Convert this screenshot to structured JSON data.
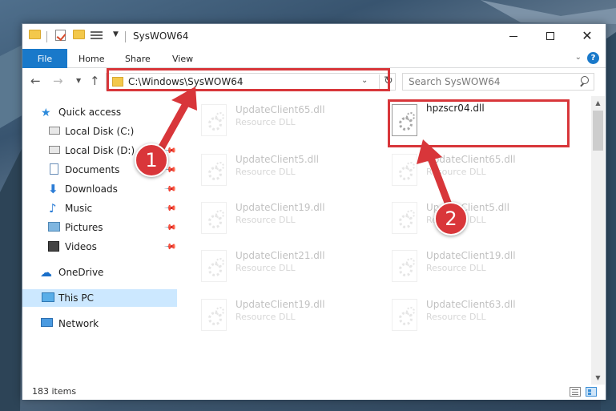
{
  "window": {
    "title": "SysWOW64"
  },
  "ribbon": {
    "tabs": [
      "File",
      "Home",
      "Share",
      "View"
    ]
  },
  "address": {
    "path": "C:\\Windows\\SysWOW64"
  },
  "search": {
    "placeholder": "Search SysWOW64"
  },
  "sidebar": {
    "items": [
      {
        "label": "Quick access",
        "icon": "star-icon"
      },
      {
        "label": "Local Disk (C:)",
        "icon": "drive-icon"
      },
      {
        "label": "Local Disk (D:)",
        "icon": "drive-icon"
      },
      {
        "label": "Documents",
        "icon": "documents-icon"
      },
      {
        "label": "Downloads",
        "icon": "download-icon"
      },
      {
        "label": "Music",
        "icon": "music-icon"
      },
      {
        "label": "Pictures",
        "icon": "pictures-icon"
      },
      {
        "label": "Videos",
        "icon": "videos-icon"
      },
      {
        "label": "OneDrive",
        "icon": "cloud-icon"
      },
      {
        "label": "This PC",
        "icon": "computer-icon"
      },
      {
        "label": "Network",
        "icon": "network-icon"
      }
    ]
  },
  "files": {
    "highlighted": {
      "name": "hpzscr04.dll"
    },
    "left_column": [
      {
        "name": "UpdateClient65.dll",
        "type": "Resource DLL"
      },
      {
        "name": "UpdateClient5.dll",
        "type": "Resource DLL"
      },
      {
        "name": "UpdateClient19.dll",
        "type": "Resource DLL"
      },
      {
        "name": "UpdateClient21.dll",
        "type": "Resource DLL"
      },
      {
        "name": "UpdateClient19.dll",
        "type": "Resource DLL"
      }
    ],
    "right_column": [
      {
        "name": "UpdateClient65.dll",
        "type": "Resource DLL"
      },
      {
        "name": "UpdateClient5.dll",
        "type": "Resource DLL"
      },
      {
        "name": "UpdateClient19.dll",
        "type": "Resource DLL"
      },
      {
        "name": "UpdateClient63.dll",
        "type": "Resource DLL"
      }
    ]
  },
  "status": {
    "item_count": "183 items"
  },
  "annotations": {
    "step1": "1",
    "step2": "2",
    "color": "#d8363a"
  }
}
